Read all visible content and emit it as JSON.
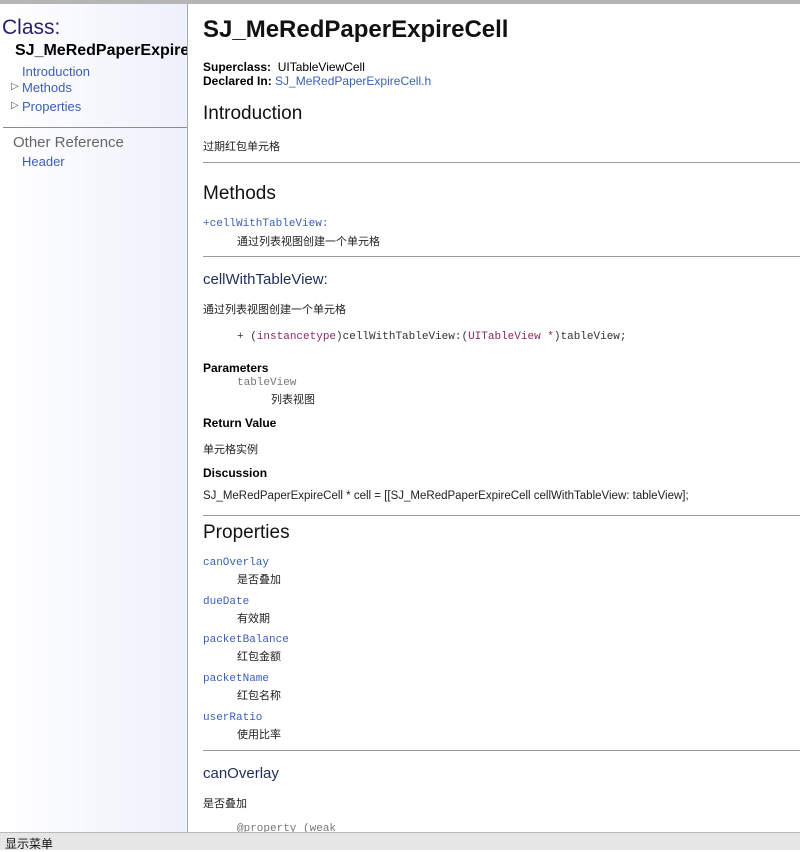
{
  "sidebar": {
    "class_label": "Class:",
    "class_name": "SJ_MeRedPaperExpireCell",
    "links": [
      "Introduction",
      "Methods",
      "Properties"
    ],
    "other_reference": "Other Reference",
    "header_link": "Header",
    "expand_glyph": "▷"
  },
  "main": {
    "title": "SJ_MeRedPaperExpireCell",
    "superclass_label": "Superclass:",
    "superclass_value": "UITableViewCell",
    "declared_label": "Declared In:",
    "declared_value": "SJ_MeRedPaperExpireCell.h",
    "intro_heading": "Introduction",
    "intro_text": "过期红包单元格",
    "methods_heading": "Methods",
    "method_link": "+cellWithTableView:",
    "method_desc": "通过列表视图创建一个单元格",
    "method_detail_heading": "cellWithTableView:",
    "method_detail_desc": "通过列表视图创建一个单元格",
    "signature": {
      "plus": "+ (",
      "return_type": "instancetype",
      "mid": ")cellWithTableView:(",
      "param_type": "UITableView *",
      "end": ")tableView;"
    },
    "parameters_label": "Parameters",
    "param_name": "tableView",
    "param_desc": "列表视图",
    "return_label": "Return Value",
    "return_desc": "单元格实例",
    "discussion_label": "Discussion",
    "discussion_text": "SJ_MeRedPaperExpireCell * cell = [[SJ_MeRedPaperExpireCell cellWithTableView: tableView];",
    "properties_heading": "Properties",
    "properties": [
      {
        "name": "canOverlay",
        "desc": "是否叠加"
      },
      {
        "name": "dueDate",
        "desc": "有效期"
      },
      {
        "name": "packetBalance",
        "desc": "红包金额"
      },
      {
        "name": "packetName",
        "desc": "红包名称"
      },
      {
        "name": "userRatio",
        "desc": "使用比率"
      }
    ],
    "prop_detail_heading": "canOverlay",
    "prop_detail_desc": "是否叠加",
    "prop_detail_code": "@property (weak"
  },
  "status_bar": {
    "text": "显示菜单"
  }
}
